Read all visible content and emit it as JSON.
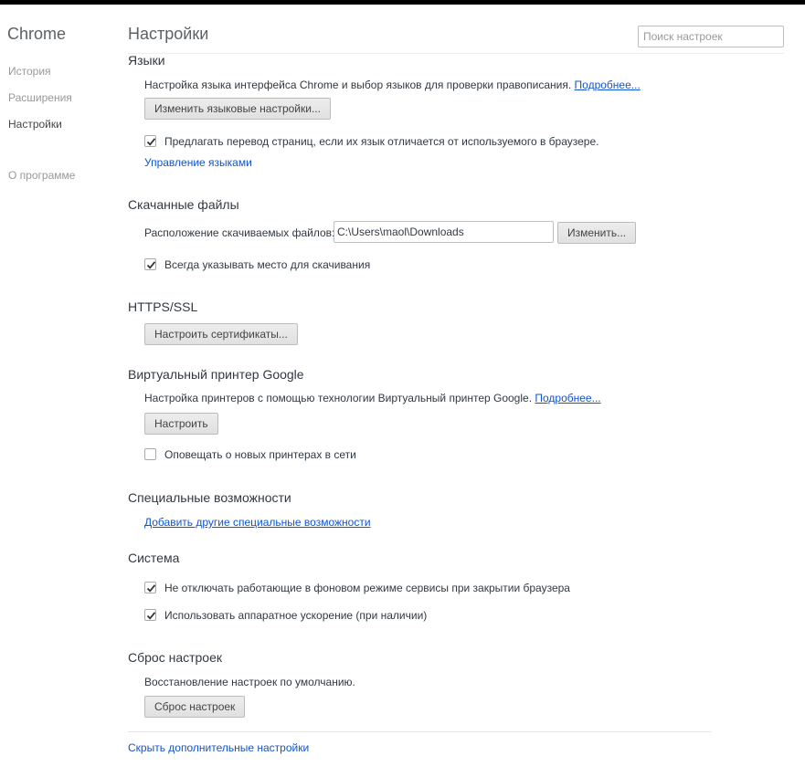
{
  "sidebar": {
    "brand": "Chrome",
    "items": [
      {
        "label": "История"
      },
      {
        "label": "Расширения"
      },
      {
        "label": "Настройки"
      },
      {
        "label": "О программе"
      }
    ]
  },
  "header": {
    "title": "Настройки",
    "search_placeholder": "Поиск настроек"
  },
  "languages": {
    "title": "Языки",
    "description": "Настройка языка интерфейса Chrome и выбор языков для проверки правописания.",
    "more_link": "Подробнее...",
    "button": "Изменить языковые настройки...",
    "translate_checkbox": {
      "label": "Предлагать перевод страниц, если их язык отличается от используемого в браузере.",
      "checked": true
    },
    "manage_link": "Управление языками"
  },
  "downloads": {
    "title": "Скачанные файлы",
    "location_label": "Расположение скачиваемых файлов:",
    "location_value": "C:\\Users\\maol\\Downloads",
    "change_button": "Изменить...",
    "ask_checkbox": {
      "label": "Всегда указывать место для скачивания",
      "checked": true
    }
  },
  "https": {
    "title": "HTTPS/SSL",
    "button": "Настроить сертификаты..."
  },
  "cloud_print": {
    "title": "Виртуальный принтер Google",
    "description": "Настройка принтеров с помощью технологии Виртуальный принтер Google.",
    "more_link": "Подробнее...",
    "button": "Настроить",
    "notify_checkbox": {
      "label": "Оповещать о новых принтерах в сети",
      "checked": false
    }
  },
  "accessibility": {
    "title": "Специальные возможности",
    "link": "Добавить другие специальные возможности"
  },
  "system": {
    "title": "Система",
    "background_checkbox": {
      "label": "Не отключать работающие в фоновом режиме сервисы при закрытии браузера",
      "checked": true
    },
    "hardware_checkbox": {
      "label": "Использовать аппаратное ускорение (при наличии)",
      "checked": true
    }
  },
  "reset": {
    "title": "Сброс настроек",
    "description": "Восстановление настроек по умолчанию.",
    "button": "Сброс настроек"
  },
  "footer": {
    "hide_advanced_link": "Скрыть дополнительные настройки"
  }
}
